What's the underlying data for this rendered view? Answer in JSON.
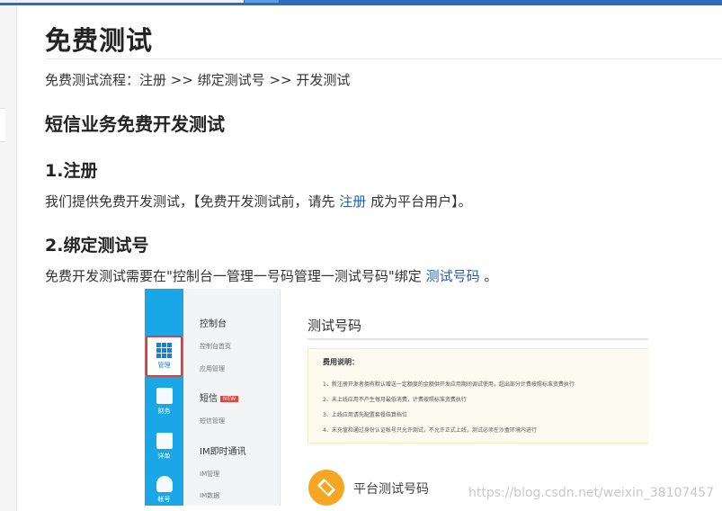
{
  "page": {
    "title": "免费测试",
    "flow_text": "免费测试流程：注册 >> 绑定测试号 >> 开发测试",
    "section_title": "短信业务免费开发测试",
    "step1": {
      "heading": "1.注册",
      "text_before": "我们提供免费开发测试，【免费开发测试前，请先",
      "link": "注册",
      "text_after": "成为平台用户】。"
    },
    "step2": {
      "heading": "2.绑定测试号",
      "text_before": "免费开发测试需要在\"控制台一管理一号码管理一测试号码\"绑定",
      "link": "测试号码",
      "text_after": "。"
    }
  },
  "embedded": {
    "rail": [
      {
        "label": "管理",
        "icon": "grid-icon",
        "active": true
      },
      {
        "label": "财务",
        "icon": "finance-icon",
        "active": false
      },
      {
        "label": "详单",
        "icon": "calendar-icon",
        "active": false
      },
      {
        "label": "帐号",
        "icon": "user-icon",
        "active": false
      }
    ],
    "menu": {
      "console": "控制台",
      "console_home": "控制台首页",
      "app_manage": "应用管理",
      "sms": "短信",
      "new_badge": "NEW",
      "sms_manage": "短信管理",
      "im": "IM即时通讯",
      "im_manage": "IM管理",
      "im_data": "IM数据"
    },
    "main_title": "测试号码",
    "notice_title": "费用说明：",
    "notice_lines": [
      "1、新注册开发者拥有默认赠送一定额度的金额供开发应用期间调试使用，超出部分计费按照标准资费执行",
      "2、未上线应用不产生每月最低消费，计费按照标准资费执行",
      "3、上线应用请先配置套餐结算档位",
      "4、未充值和通过身份认证帐号只允许测试，不允许正式上线，测试必须在沙盒环境内进行"
    ],
    "platform_numbers": "平台测试号码"
  },
  "watermark": "https://blog.csdn.net/weixin_38107457",
  "colors": {
    "top_bar": "#2a6ebb",
    "link": "#2a5db0",
    "rail": "#1aa7e8",
    "active_border": "#e23b3b",
    "badge": "#f5a623"
  }
}
